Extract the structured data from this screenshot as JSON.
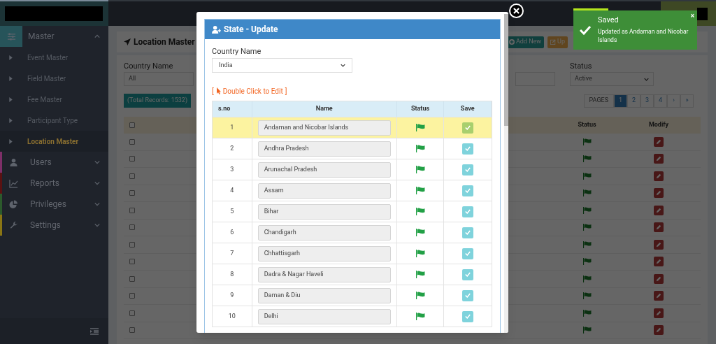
{
  "sidebar": {
    "sections": [
      {
        "label": "Master",
        "expanded": true,
        "children": [
          {
            "label": "Event Master",
            "selected": false
          },
          {
            "label": "Field Master",
            "selected": false
          },
          {
            "label": "Fee Master",
            "selected": false
          },
          {
            "label": "Participant Type",
            "selected": false
          },
          {
            "label": "Location Master",
            "selected": true
          }
        ]
      },
      {
        "label": "Users",
        "expanded": false,
        "color": "#7e2f68"
      },
      {
        "label": "Reports",
        "expanded": false,
        "color": "#5a1212"
      },
      {
        "label": "Privileges",
        "expanded": false,
        "color": "#2c5a2c"
      },
      {
        "label": "Settings",
        "expanded": false,
        "color": "#8a7514"
      }
    ]
  },
  "page": {
    "title": "Location Master",
    "buttons": [
      "Add New",
      "Up"
    ],
    "filters": [
      {
        "label": "Country Name",
        "value": "All"
      },
      {
        "label": "Status",
        "value": "Active"
      }
    ],
    "total_records": "(Total Records: 1532)",
    "pagination": {
      "label": "PAGES",
      "pages": [
        {
          "label": "1",
          "selected": true
        },
        {
          "label": "2",
          "selected": false
        },
        {
          "label": "3",
          "selected": false
        },
        {
          "label": "4",
          "selected": false
        },
        {
          "label": "›",
          "selected": false
        },
        {
          "label": "»",
          "selected": false
        }
      ]
    },
    "table": {
      "columns": [
        "Status",
        "Modify"
      ],
      "header_checked": false,
      "rows": [
        {
          "checked": false
        },
        {
          "checked": false
        },
        {
          "checked": false
        },
        {
          "checked": false
        },
        {
          "checked": false
        },
        {
          "checked": false
        },
        {
          "checked": false
        },
        {
          "checked": false
        },
        {
          "checked": false
        },
        {
          "checked": false
        },
        {
          "checked": false
        },
        {
          "checked": false
        }
      ]
    }
  },
  "modal": {
    "title": "State - Update",
    "country": {
      "label": "Country Name",
      "value": "India"
    },
    "hint": {
      "open": "[",
      "text": "Double Click to Edit",
      "close": "]"
    },
    "columns": [
      "s.no",
      "Name",
      "Status",
      "Save"
    ],
    "rows": [
      {
        "sno": "1",
        "name": "Andaman and Nicobar Islands",
        "active": true,
        "selected": true
      },
      {
        "sno": "2",
        "name": "Andhra Pradesh",
        "active": true,
        "selected": false
      },
      {
        "sno": "3",
        "name": "Arunachal Pradesh",
        "active": true,
        "selected": false
      },
      {
        "sno": "4",
        "name": "Assam",
        "active": true,
        "selected": false
      },
      {
        "sno": "5",
        "name": "Bihar",
        "active": true,
        "selected": false
      },
      {
        "sno": "6",
        "name": "Chandigarh",
        "active": true,
        "selected": false
      },
      {
        "sno": "7",
        "name": "Chhattisgarh",
        "active": true,
        "selected": false
      },
      {
        "sno": "8",
        "name": "Dadra & Nagar Haveli",
        "active": true,
        "selected": false
      },
      {
        "sno": "9",
        "name": "Daman & Diu",
        "active": true,
        "selected": false
      },
      {
        "sno": "10",
        "name": "Delhi",
        "active": true,
        "selected": false
      }
    ]
  },
  "toast": {
    "title": "Saved",
    "message": "Updated as Andaman and Nicobar Islands",
    "close": "×",
    "level": 0.28
  }
}
